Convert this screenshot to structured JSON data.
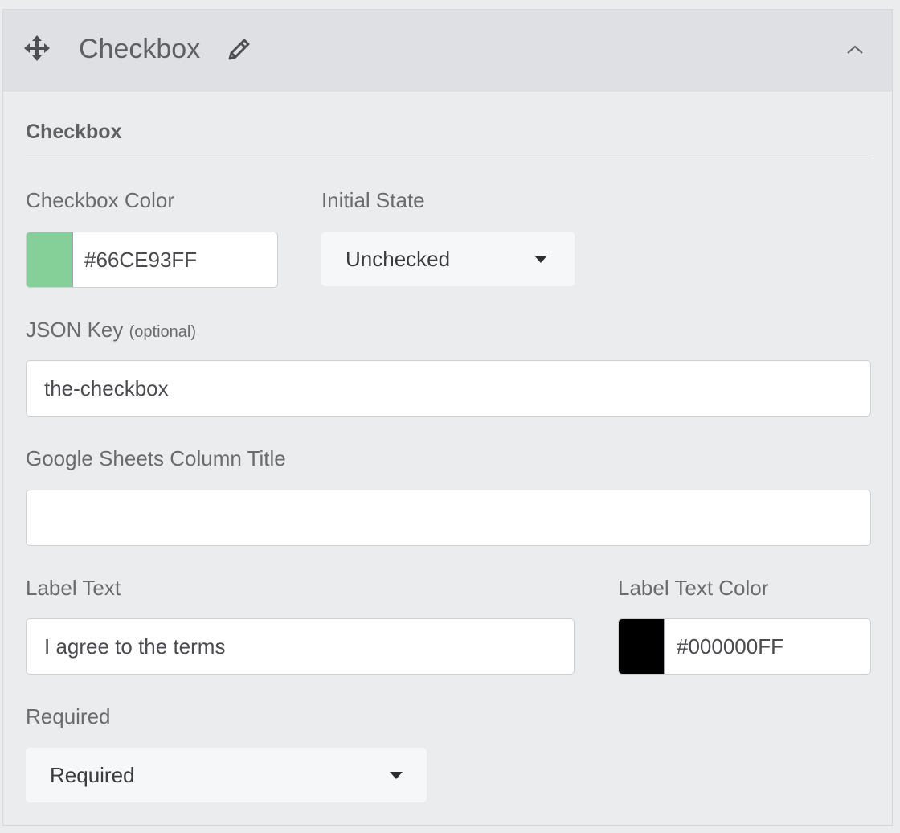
{
  "header": {
    "title": "Checkbox",
    "icons": [
      "move-icon",
      "pencil-icon",
      "chevron-up-icon"
    ]
  },
  "section": {
    "title": "Checkbox"
  },
  "checkbox_color": {
    "label": "Checkbox Color",
    "value": "#66CE93FF",
    "swatch_color": "#85cf98"
  },
  "initial_state": {
    "label": "Initial State",
    "selected": "Unchecked"
  },
  "json_key": {
    "label": "JSON Key",
    "label_note": "(optional)",
    "value": "the-checkbox"
  },
  "sheets_column": {
    "label": "Google Sheets Column Title",
    "value": ""
  },
  "label_text": {
    "label": "Label Text",
    "value": "I agree to the terms"
  },
  "label_text_color": {
    "label": "Label Text Color",
    "value": "#000000FF",
    "swatch_color": "#000000"
  },
  "required": {
    "label": "Required",
    "selected": "Required"
  }
}
